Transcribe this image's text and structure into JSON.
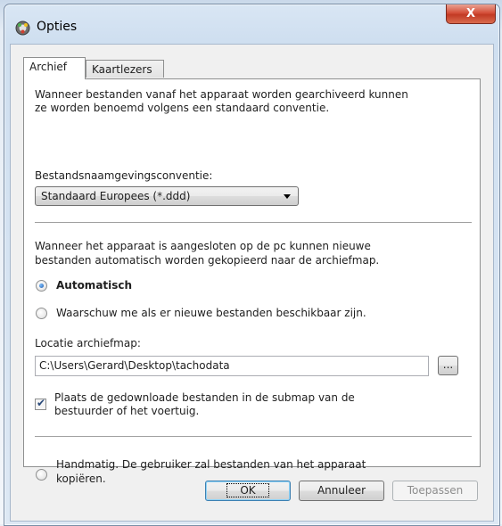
{
  "window": {
    "title": "Opties",
    "close_label": "X"
  },
  "tabs": [
    {
      "label": "Archief",
      "active": true
    },
    {
      "label": "Kaartlezers",
      "active": false
    }
  ],
  "archief": {
    "intro_line1": "Wanneer bestanden vanaf het apparaat worden gearchiveerd kunnen",
    "intro_line2": "ze worden benoemd volgens een standaard conventie.",
    "naming_label": "Bestandsnaamgevingsconventie:",
    "naming_selected": "Standaard Europees (*.ddd)",
    "connect_line1": "Wanneer het apparaat is aangesloten op de pc kunnen nieuwe",
    "connect_line2": "bestanden automatisch worden gekopieerd naar de archiefmap.",
    "radio_auto": "Automatisch",
    "radio_warn": "Waarschuw me als er nieuwe bestanden beschikbaar zijn.",
    "location_label": "Locatie archiefmap:",
    "location_value": "C:\\Users\\Gerard\\Desktop\\tachodata",
    "browse_label": "...",
    "checkbox_line1": "Plaats de gedownloade bestanden in de submap van de",
    "checkbox_line2": "bestuurder of het voertuig.",
    "checkbox_checked": true,
    "radio_manual_line1": "Handmatig. De gebruiker zal bestanden van het apparaat",
    "radio_manual_line2": "kopiëren.",
    "selected_radio": "Automatisch"
  },
  "buttons": {
    "ok": "OK",
    "cancel": "Annuleer",
    "apply": "Toepassen"
  },
  "colors": {
    "close_button": "#c23a24",
    "radio_dot": "#1c58a8"
  }
}
